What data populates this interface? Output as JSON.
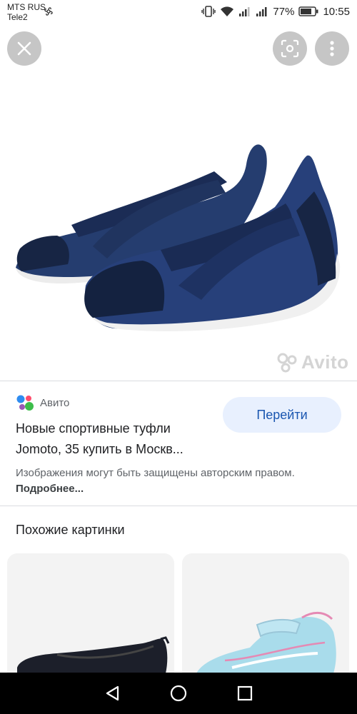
{
  "status_bar": {
    "carrier_1": "MTS RUS",
    "carrier_2": "Tele2",
    "battery": "77%",
    "time": "10:55"
  },
  "top_controls": {
    "close_icon": "close-icon",
    "lens_icon": "lens-icon",
    "more_icon": "more-vert-icon"
  },
  "image": {
    "watermark": "Avito"
  },
  "source": {
    "name": "Авито",
    "title_line_1": "Новые спортивные туфли",
    "title_line_2": "Jomoto, 35 купить в Москв...",
    "visit_label": "Перейти",
    "copyright_text": "Изображения могут быть защищены авторским правом.",
    "more_link": "Подробнее..."
  },
  "similar": {
    "heading": "Похожие картинки"
  },
  "colors": {
    "accent": "#1a56b0",
    "button_bg": "#e8f0fe",
    "shoe_navy": "#233c6b"
  }
}
